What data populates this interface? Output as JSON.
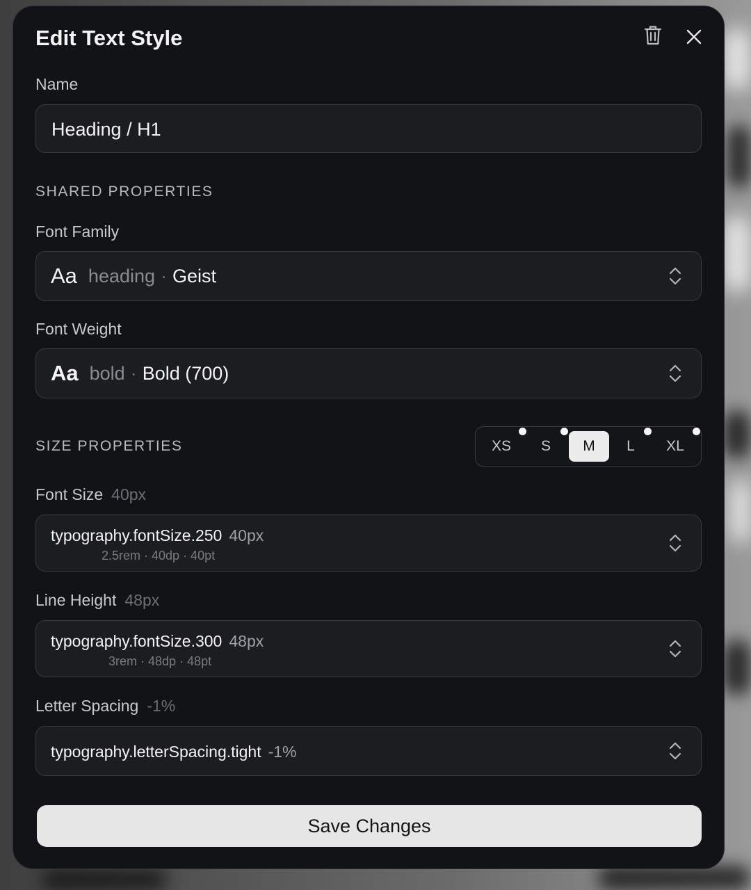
{
  "dialog": {
    "title": "Edit Text Style",
    "icons": {
      "delete": "trash-icon",
      "close": "close-icon"
    }
  },
  "name": {
    "label": "Name",
    "value": "Heading / H1"
  },
  "shared": {
    "section_label": "SHARED PROPERTIES",
    "font_family": {
      "label": "Font Family",
      "preview": "Aa",
      "token": "heading",
      "separator": "·",
      "value": "Geist"
    },
    "font_weight": {
      "label": "Font Weight",
      "preview": "Aa",
      "token": "bold",
      "separator": "·",
      "value": "Bold (700)"
    }
  },
  "size": {
    "section_label": "SIZE PROPERTIES",
    "sizes": [
      "XS",
      "S",
      "M",
      "L",
      "XL"
    ],
    "selected": "M",
    "font_size": {
      "label": "Font Size",
      "meta": "40px",
      "token": "typography.fontSize.250",
      "value": "40px",
      "conversions": "2.5rem · 40dp · 40pt"
    },
    "line_height": {
      "label": "Line Height",
      "meta": "48px",
      "token": "typography.fontSize.300",
      "value": "48px",
      "conversions": "3rem · 48dp · 48pt"
    },
    "letter_spacing": {
      "label": "Letter Spacing",
      "meta": "-1%",
      "token": "typography.letterSpacing.tight",
      "value": "-1%"
    }
  },
  "actions": {
    "save_label": "Save Changes"
  },
  "colors": {
    "modal_bg": "#121316",
    "field_bg": "#1c1d20",
    "save_bg": "#e6e6e7"
  }
}
